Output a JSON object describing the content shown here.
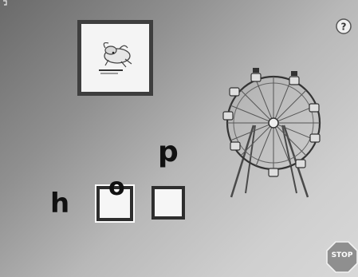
{
  "game": {
    "word_letters": {
      "first": "h",
      "placed": "o",
      "draggable": "p"
    },
    "picture_card": {
      "icon": "hop-picture-icon"
    },
    "controls": {
      "help_symbol": "?",
      "stop_label": "STOP"
    },
    "scene": {
      "decoration": "ferris-wheel-icon"
    },
    "colors": {
      "background_dark": "#6a6a6a",
      "background_light": "#d8d8d8",
      "slot_fill": "#f6f6f6",
      "slot_border": "#2e2e2e",
      "stop_sign": "#8f8f8f"
    }
  }
}
